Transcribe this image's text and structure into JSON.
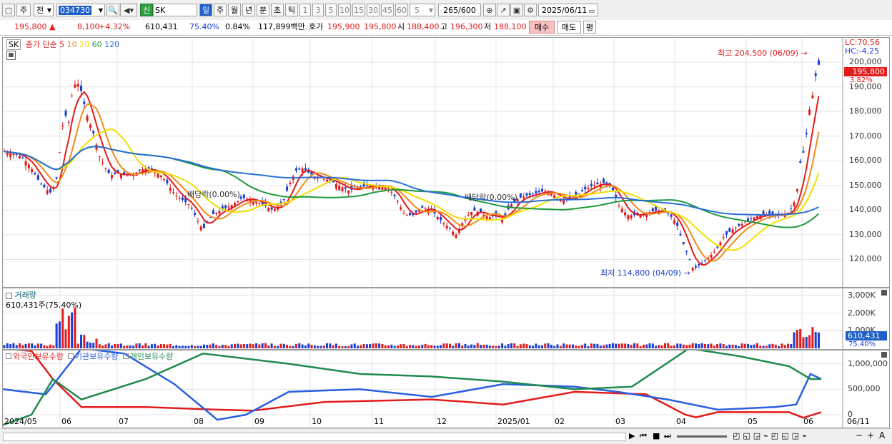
{
  "toolbar": {
    "period_1": "주",
    "period_2": "전",
    "code": "034730",
    "credit_badge": "신",
    "stock_name": "SK",
    "tabs": [
      "일",
      "주",
      "월",
      "년",
      "분",
      "초",
      "틱"
    ],
    "minutes": [
      "1",
      "3",
      "5",
      "10",
      "15",
      "30",
      "45",
      "60"
    ],
    "custom_min": "5",
    "count": "265",
    "total": "/600",
    "date": "2025/06/11"
  },
  "quote": {
    "price": "195,800",
    "change": "8,100",
    "rate": "+4.32%",
    "volume": "610,431",
    "vol_ratio": "75.40%",
    "turnover": "0.84%",
    "amount": "117,899백만",
    "hoga_label": "호가",
    "ask": "195,900",
    "bid": "195,800",
    "open_label": "시",
    "open": "188,400",
    "high_label": "고",
    "high": "196,300",
    "low_label": "저",
    "low": "188,100",
    "buy_btn": "매수",
    "sell_btn": "매도",
    "eval_btn": "평"
  },
  "legend": {
    "symbol": "SK",
    "indicator": "종가 단순",
    "ma": [
      {
        "label": "5",
        "color": "#e31b1b"
      },
      {
        "label": "10",
        "color": "#f08c1c"
      },
      {
        "label": "20",
        "color": "#f0e000"
      },
      {
        "label": "60",
        "color": "#1f9a3c"
      },
      {
        "label": "120",
        "color": "#2a6fd8"
      }
    ]
  },
  "price_axis": {
    "lc": "LC:70.56",
    "hc": "HC:-4.25",
    "ticks": [
      "200,000",
      "190,000",
      "180,000",
      "170,000",
      "160,000",
      "150,000",
      "140,000",
      "130,000",
      "120,000"
    ],
    "current": "195,800",
    "current_pct": "3.82%"
  },
  "annotations": {
    "high": "최고 204,500 (06/09)",
    "low": "최저 114,800 (04/09)",
    "dividend_1": "배당락(0.00%)",
    "dividend_2": "배당락(0.00%)"
  },
  "volume": {
    "title": "거래량",
    "value": "610,431주(75.40%)",
    "ticks": [
      "3,000K",
      "2,000K",
      "1,000K"
    ],
    "current": "610,431",
    "current_pct": "75.40%"
  },
  "holdings": {
    "legend": [
      {
        "label": "외국인보유수량",
        "color": "#e31b1b"
      },
      {
        "label": "기관보유수량",
        "color": "#2a5fe0"
      },
      {
        "label": "개인보유수량",
        "color": "#1f8a4c"
      }
    ],
    "ticks": [
      "1,000,000",
      "500,000",
      "0"
    ]
  },
  "x_labels": [
    "2024/05",
    "06",
    "07",
    "08",
    "09",
    "10",
    "11",
    "12",
    "2025/01",
    "02",
    "03",
    "04",
    "05",
    "06"
  ],
  "x_right_label": "06/11",
  "chart_data": {
    "type": "candlestick",
    "ylim": [
      110000,
      207000
    ],
    "points": [
      [
        0,
        164000
      ],
      [
        12,
        163000
      ],
      [
        25,
        162000
      ],
      [
        38,
        158000
      ],
      [
        52,
        151000
      ],
      [
        66,
        147000
      ],
      [
        74,
        150000
      ],
      [
        80,
        165000
      ],
      [
        86,
        180000
      ],
      [
        92,
        175000
      ],
      [
        98,
        190000
      ],
      [
        104,
        192000
      ],
      [
        110,
        188000
      ],
      [
        116,
        180000
      ],
      [
        122,
        175000
      ],
      [
        128,
        170000
      ],
      [
        135,
        162000
      ],
      [
        142,
        158000
      ],
      [
        150,
        154000
      ],
      [
        160,
        155000
      ],
      [
        172,
        154000
      ],
      [
        185,
        155000
      ],
      [
        198,
        157000
      ],
      [
        210,
        156000
      ],
      [
        222,
        154000
      ],
      [
        232,
        150000
      ],
      [
        242,
        146000
      ],
      [
        252,
        144000
      ],
      [
        262,
        142000
      ],
      [
        272,
        136000
      ],
      [
        280,
        132000
      ],
      [
        292,
        138000
      ],
      [
        306,
        140000
      ],
      [
        320,
        142000
      ],
      [
        335,
        145000
      ],
      [
        350,
        144000
      ],
      [
        365,
        142000
      ],
      [
        378,
        140000
      ],
      [
        392,
        143000
      ],
      [
        400,
        150000
      ],
      [
        410,
        156000
      ],
      [
        420,
        157000
      ],
      [
        432,
        154000
      ],
      [
        445,
        153000
      ],
      [
        458,
        152000
      ],
      [
        470,
        150000
      ],
      [
        484,
        148000
      ],
      [
        498,
        149000
      ],
      [
        512,
        150000
      ],
      [
        525,
        150000
      ],
      [
        540,
        149000
      ],
      [
        552,
        144000
      ],
      [
        562,
        138000
      ],
      [
        574,
        138000
      ],
      [
        586,
        141000
      ],
      [
        600,
        140000
      ],
      [
        612,
        136000
      ],
      [
        624,
        133000
      ],
      [
        634,
        130000
      ],
      [
        645,
        136000
      ],
      [
        658,
        140000
      ],
      [
        668,
        139000
      ],
      [
        680,
        137000
      ],
      [
        690,
        138000
      ],
      [
        700,
        136000
      ],
      [
        710,
        142000
      ],
      [
        722,
        145000
      ],
      [
        735,
        146000
      ],
      [
        748,
        147000
      ],
      [
        760,
        148000
      ],
      [
        772,
        146000
      ],
      [
        785,
        144000
      ],
      [
        798,
        145000
      ],
      [
        812,
        148000
      ],
      [
        825,
        150000
      ],
      [
        840,
        151000
      ],
      [
        852,
        149000
      ],
      [
        862,
        142000
      ],
      [
        874,
        138000
      ],
      [
        888,
        138000
      ],
      [
        902,
        139000
      ],
      [
        916,
        140000
      ],
      [
        930,
        139000
      ],
      [
        942,
        135000
      ],
      [
        950,
        128000
      ],
      [
        958,
        122000
      ],
      [
        966,
        116000
      ],
      [
        976,
        118000
      ],
      [
        988,
        121000
      ],
      [
        998,
        124000
      ],
      [
        1008,
        129000
      ],
      [
        1020,
        132000
      ],
      [
        1032,
        134000
      ],
      [
        1044,
        136000
      ],
      [
        1058,
        138000
      ],
      [
        1072,
        138000
      ],
      [
        1086,
        138000
      ],
      [
        1100,
        139000
      ],
      [
        1110,
        145000
      ],
      [
        1116,
        160000
      ],
      [
        1122,
        165000
      ],
      [
        1128,
        180000
      ],
      [
        1134,
        188000
      ],
      [
        1140,
        200000
      ],
      [
        1146,
        195800
      ]
    ]
  }
}
